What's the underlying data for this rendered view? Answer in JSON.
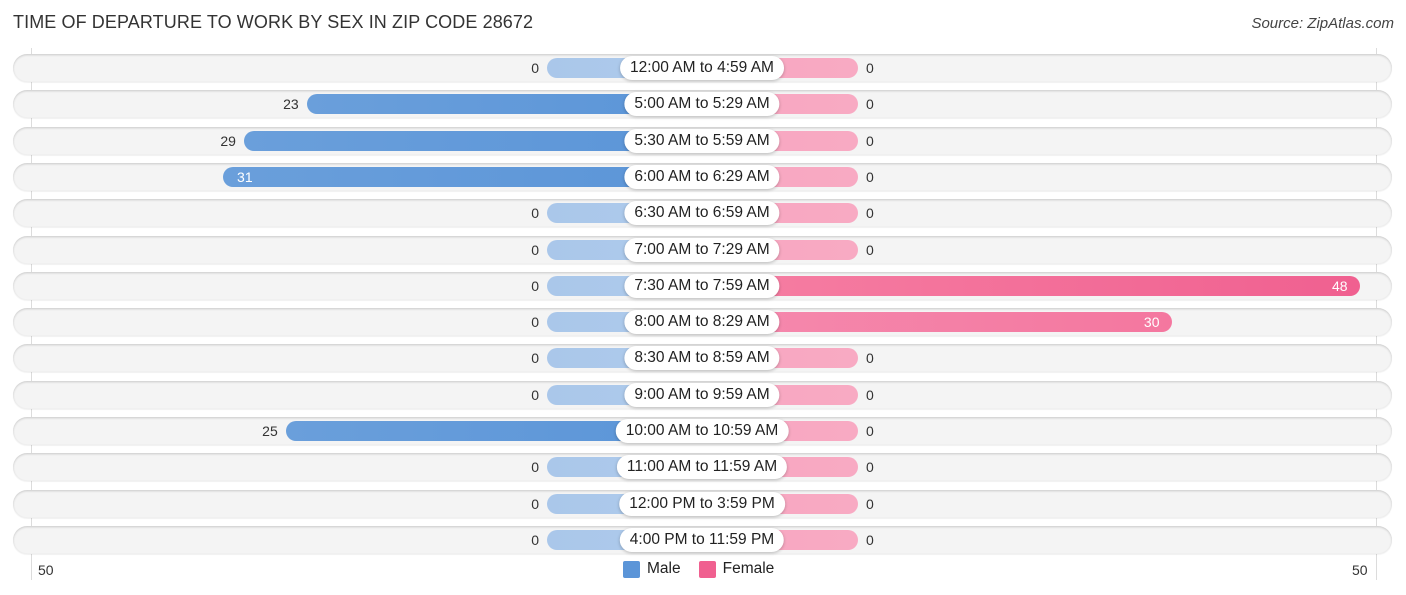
{
  "title": "TIME OF DEPARTURE TO WORK BY SEX IN ZIP CODE 28672",
  "source": "Source: ZipAtlas.com",
  "colors": {
    "male": "#5b95d8",
    "male_zero": "#aac7ea",
    "female": "#f06090",
    "female_zero": "#f7a6c0"
  },
  "chart_data": {
    "type": "bar",
    "orientation": "horizontal-diverging",
    "title": "TIME OF DEPARTURE TO WORK BY SEX IN ZIP CODE 28672",
    "categories": [
      "12:00 AM to 4:59 AM",
      "5:00 AM to 5:29 AM",
      "5:30 AM to 5:59 AM",
      "6:00 AM to 6:29 AM",
      "6:30 AM to 6:59 AM",
      "7:00 AM to 7:29 AM",
      "7:30 AM to 7:59 AM",
      "8:00 AM to 8:29 AM",
      "8:30 AM to 8:59 AM",
      "9:00 AM to 9:59 AM",
      "10:00 AM to 10:59 AM",
      "11:00 AM to 11:59 AM",
      "12:00 PM to 3:59 PM",
      "4:00 PM to 11:59 PM"
    ],
    "series": [
      {
        "name": "Male",
        "values": [
          0,
          23,
          29,
          31,
          0,
          0,
          0,
          0,
          0,
          0,
          25,
          0,
          0,
          0
        ]
      },
      {
        "name": "Female",
        "values": [
          0,
          0,
          0,
          0,
          0,
          0,
          48,
          30,
          0,
          0,
          0,
          0,
          0,
          0
        ]
      }
    ],
    "axis": {
      "left_label": "50",
      "right_label": "50",
      "range": [
        0,
        50
      ]
    },
    "legend": {
      "position": "bottom-center",
      "entries": [
        "Male",
        "Female"
      ]
    }
  }
}
